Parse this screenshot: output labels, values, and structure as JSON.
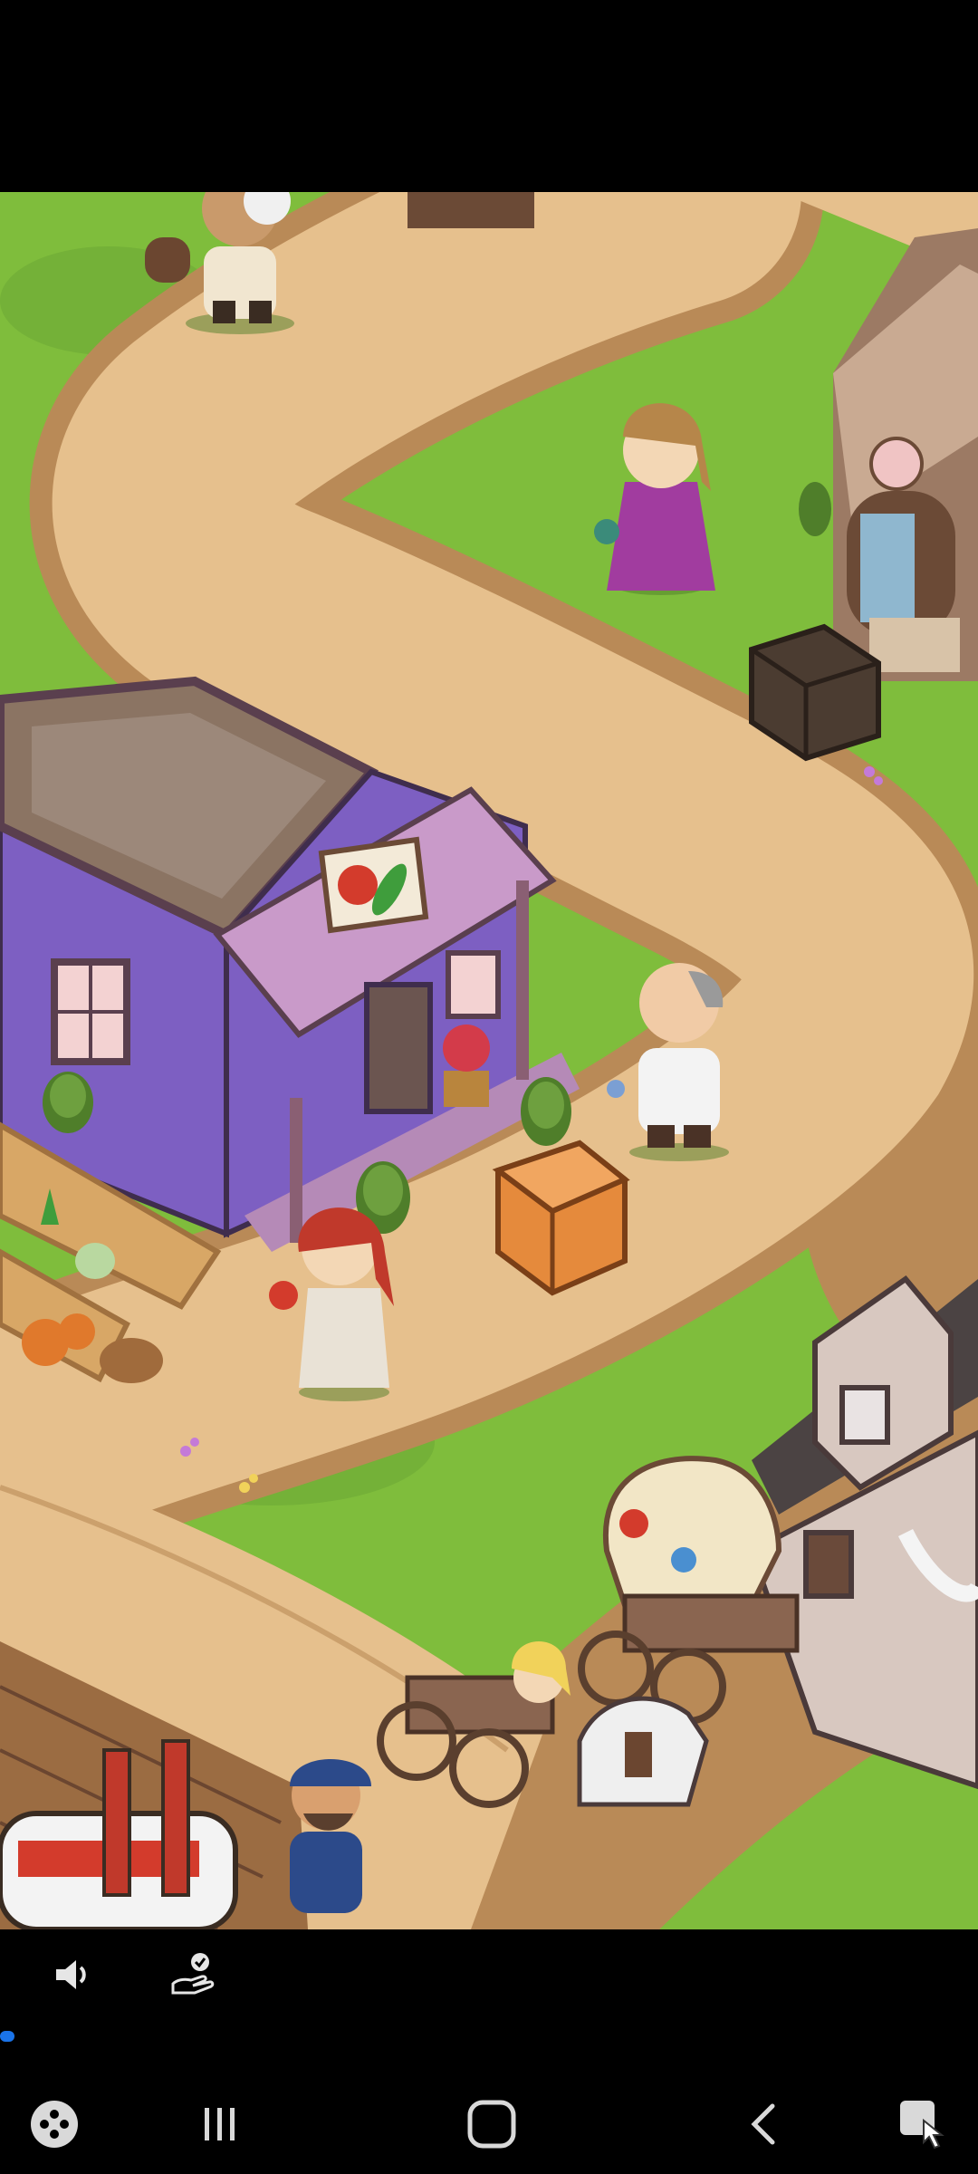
{
  "colors": {
    "grass": "#7fbd3c",
    "grass_dark": "#5e9a2e",
    "path": "#e6c08d",
    "path_edge": "#b98a57",
    "shop_wall": "#7d5fc2",
    "shop_trim": "#8a5f73",
    "roof_top": "#8b7463",
    "progress": "#1a73e8",
    "icon": "#d9d9d9"
  },
  "video_controls": {
    "sound_icon": "volume-icon",
    "cast_icon": "cast-icon"
  },
  "progress": {
    "fraction": 0.015
  },
  "nav": {
    "game_tools_icon": "gamepad-icon",
    "recents_icon": "recents-icon",
    "home_icon": "home-icon",
    "back_icon": "back-icon",
    "screenshot_icon": "screen-capture-icon"
  }
}
